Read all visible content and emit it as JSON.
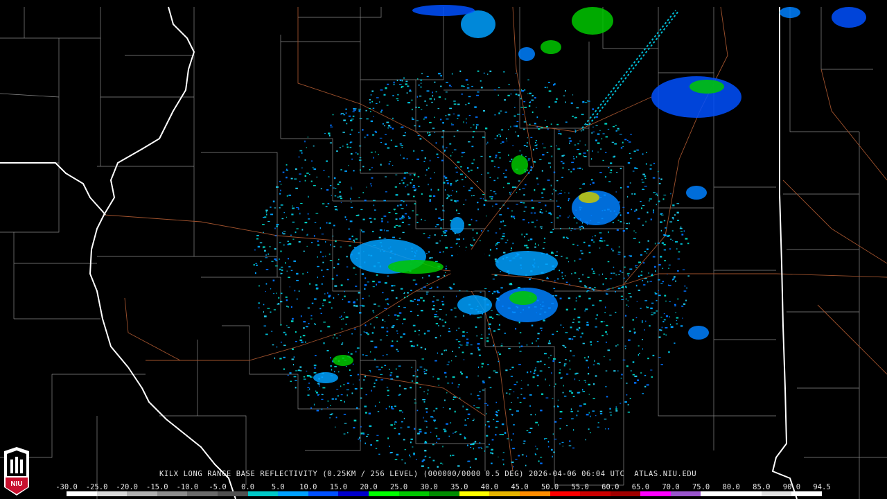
{
  "map": {
    "radar_site": "KILX",
    "product": "Long Range Base Reflectivity",
    "background_color": "#000000",
    "state_border_color": "#ffffff",
    "county_line_color": "#8a8a8a",
    "highway_color": "#a0522d"
  },
  "caption": {
    "text": "KILX LONG RANGE BASE REFLECTIVITY (0.25KM / 256 LEVEL) (000000/0000 0.5 DEG) 2026-04-06 06:04 UTC  ATLAS.NIU.EDU"
  },
  "color_scale": {
    "labels": [
      "-30.0",
      "-25.0",
      "-20.0",
      "-15.0",
      "-10.0",
      "-5.0",
      "0.0",
      "5.0",
      "10.0",
      "15.0",
      "20.0",
      "25.0",
      "30.0",
      "35.0",
      "40.0",
      "45.0",
      "50.0",
      "55.0",
      "60.0",
      "65.0",
      "70.0",
      "75.0",
      "80.0",
      "85.0",
      "90.0",
      "94.5"
    ],
    "colors": [
      "#ffffff",
      "#d8d8d8",
      "#b0b0b0",
      "#8c8c8c",
      "#6a6a6a",
      "#505050",
      "#00c8c8",
      "#00a0ff",
      "#0050ff",
      "#0000cc",
      "#00ff00",
      "#00c800",
      "#008c00",
      "#ffff00",
      "#e6b400",
      "#ff8c00",
      "#ff0000",
      "#cc0000",
      "#a00000",
      "#ff00ff",
      "#9955cc",
      "#ffffff",
      "#ffffff",
      "#e0e0e0",
      "#ffffff"
    ]
  },
  "logo": {
    "text": "NIU",
    "color": "#c8102e"
  }
}
